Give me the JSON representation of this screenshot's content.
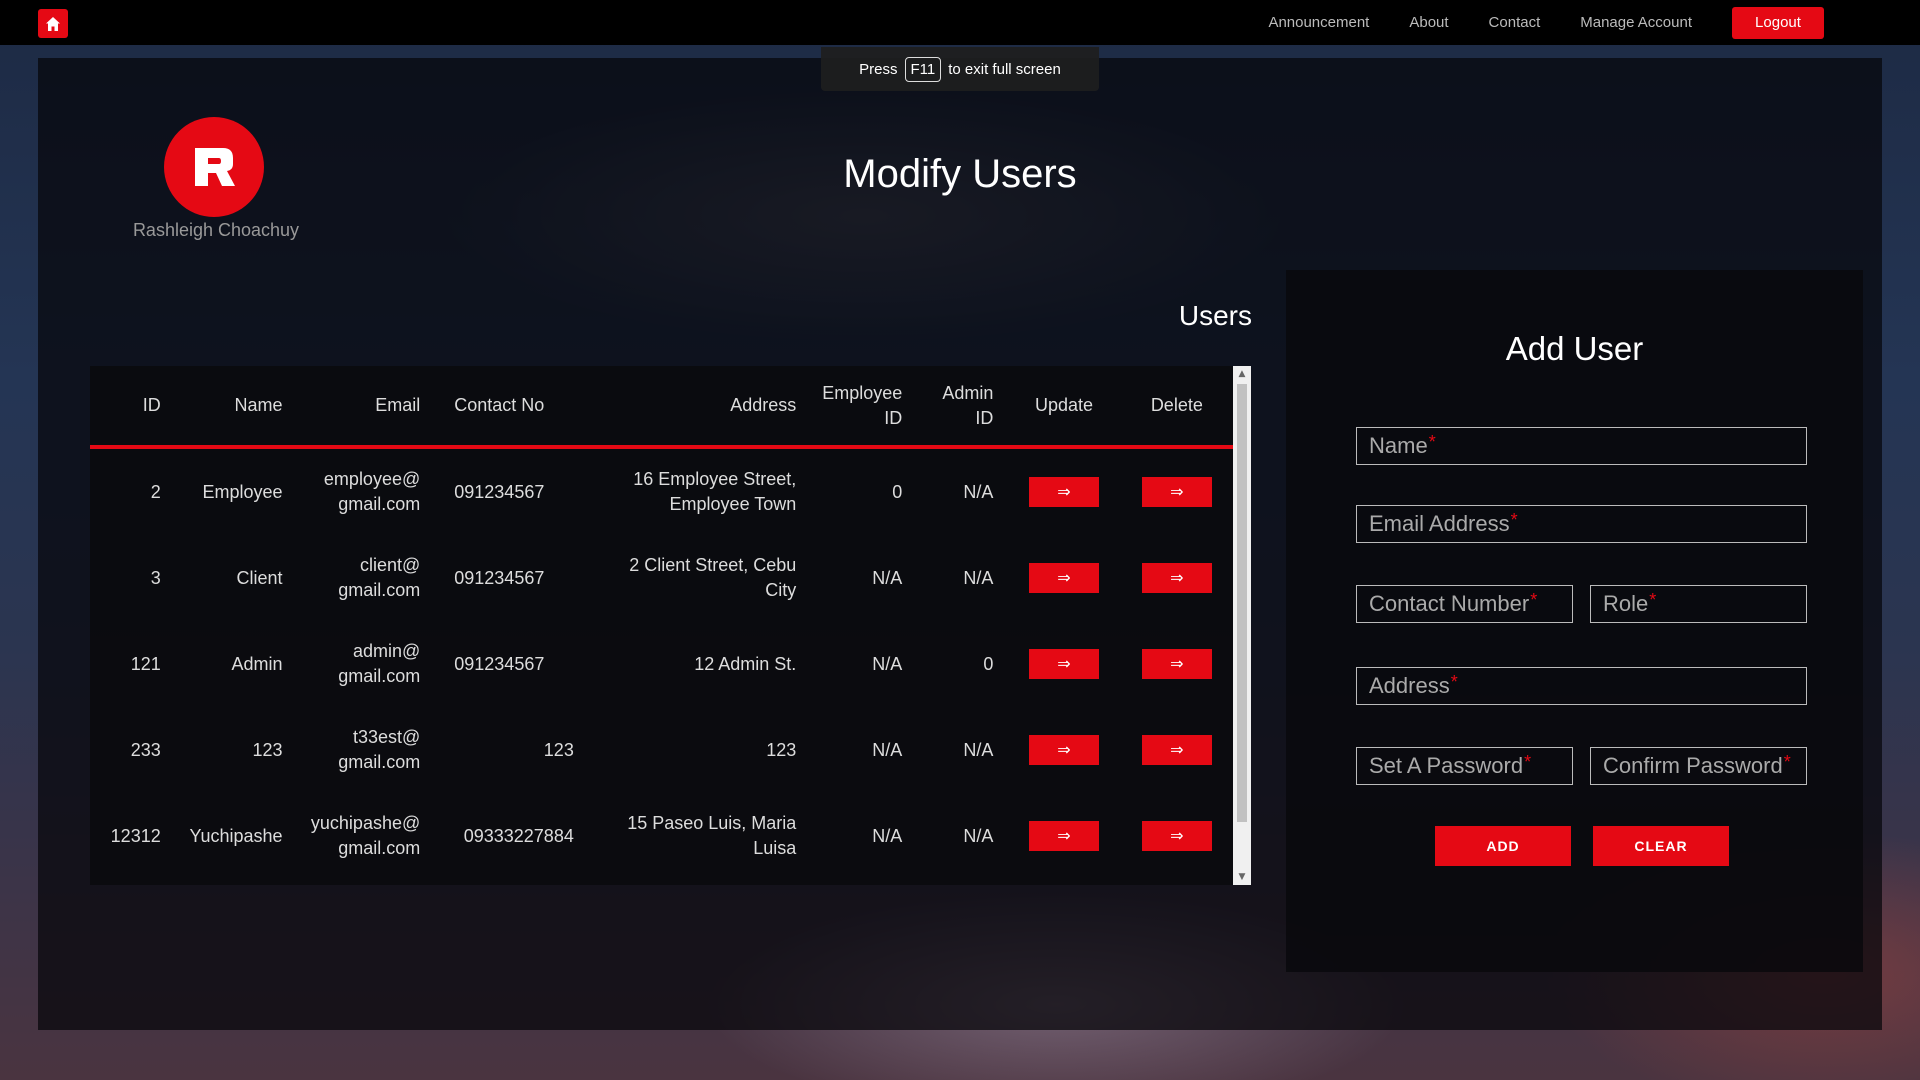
{
  "nav": {
    "home_icon": "home-icon",
    "items": [
      "Announcement",
      "About",
      "Contact",
      "Manage Account"
    ],
    "logout_label": "Logout"
  },
  "fullscreen_notice": {
    "prefix": "Press",
    "key": "F11",
    "suffix": "to exit full screen"
  },
  "brand": {
    "name": "Rashleigh Choachuy",
    "logo_letter": "R"
  },
  "page": {
    "title": "Modify Users",
    "table_heading": "Users"
  },
  "colors": {
    "accent": "#e50914",
    "background": "#000000"
  },
  "table": {
    "columns": [
      "ID",
      "Name",
      "Email",
      "Contact No",
      "Address",
      "Employee ID",
      "Admin ID",
      "Update",
      "Delete"
    ],
    "column_lines": {
      "employee_id": [
        "Employee",
        "ID"
      ],
      "admin_id": [
        "Admin",
        "ID"
      ]
    },
    "action_symbol": "⇒",
    "rows": [
      {
        "id": "2",
        "name": "Employee",
        "email": [
          "employee@",
          "gmail.com"
        ],
        "contact": "091234567",
        "address": [
          "16 Employee Street,",
          "Employee Town"
        ],
        "employee_id": "0",
        "admin_id": "N/A"
      },
      {
        "id": "3",
        "name": "Client",
        "email": [
          "client@",
          "gmail.com"
        ],
        "contact": "091234567",
        "address": [
          "2 Client Street, Cebu",
          "City"
        ],
        "employee_id": "N/A",
        "admin_id": "N/A"
      },
      {
        "id": "121",
        "name": "Admin",
        "email": [
          "admin@",
          "gmail.com"
        ],
        "contact": "091234567",
        "address": [
          "12 Admin St.",
          ""
        ],
        "employee_id": "N/A",
        "admin_id": "0"
      },
      {
        "id": "233",
        "name": "123",
        "email": [
          "t33est@",
          "gmail.com"
        ],
        "contact": "123",
        "address": [
          "123",
          ""
        ],
        "employee_id": "N/A",
        "admin_id": "N/A"
      },
      {
        "id": "12312",
        "name": "Yuchipashe",
        "email": [
          "yuchipashe@",
          "gmail.com"
        ],
        "contact": "09333227884",
        "address": [
          "15 Paseo Luis, Maria",
          "Luisa"
        ],
        "employee_id": "N/A",
        "admin_id": "N/A"
      }
    ]
  },
  "form": {
    "title": "Add User",
    "fields": {
      "name": "Name",
      "email": "Email Address",
      "contact": "Contact Number",
      "role": "Role",
      "address": "Address",
      "password": "Set A Password",
      "confirm": "Confirm Password"
    },
    "required_marker": "*",
    "add_label": "ADD",
    "clear_label": "CLEAR"
  }
}
